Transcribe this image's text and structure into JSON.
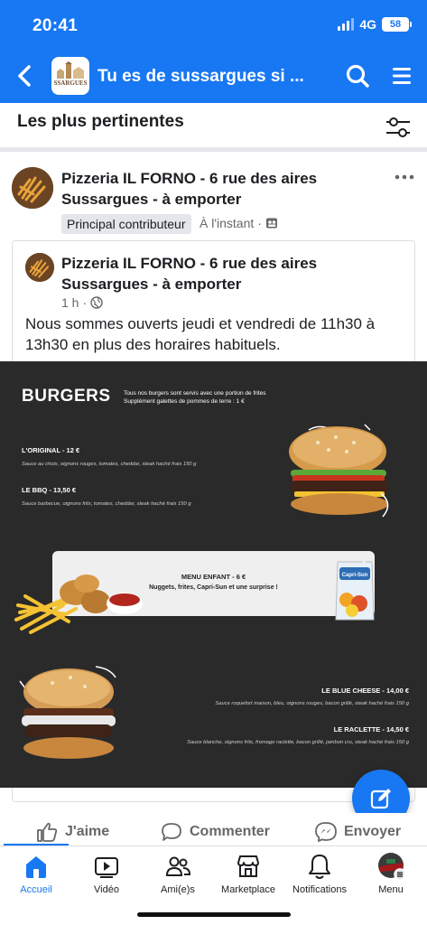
{
  "status_bar": {
    "time": "20:41",
    "network": "4G",
    "battery": "58"
  },
  "header": {
    "group_logo_text": "SSARGUES",
    "title": "Tu es de sussargues si ...",
    "icons": [
      "back-icon",
      "search-icon",
      "hamburger-menu-icon"
    ]
  },
  "sort": {
    "label": "Les plus pertinentes",
    "icon": "filter-sliders-icon"
  },
  "post": {
    "author_line1": "Pizzeria IL FORNO - 6 rue des aires",
    "author_line2": "Sussargues - à emporter",
    "badge": "Principal contributeur",
    "time": "À l'instant",
    "separator": "·",
    "shared": {
      "author_line1": "Pizzeria IL FORNO - 6 rue des aires",
      "author_line2": "Sussargues - à emporter",
      "time": "1 h",
      "separator": "·",
      "text": "Nous sommes ouverts jeudi et vendredi de 11h30 à 13h30 en plus des horaires habituels."
    }
  },
  "menu_image": {
    "title": "BURGERS",
    "note_line1": "Tous nos burgers sont servis avec une portion de frites",
    "note_line2": "Supplément galettes de pommes de terre : 1 €",
    "items": [
      {
        "name": "L'ORIGINAL - 12 €",
        "desc": "Sauce au choix, oignons rouges, tomates, cheddar, steak haché frais 150 g"
      },
      {
        "name": "LE BBQ - 13,50 €",
        "desc": "Sauce barbecue, oignons frits, tomates, cheddar, steak haché frais 150 g"
      },
      {
        "name": "LE BLUE CHEESE - 14,00 €",
        "desc": "Sauce roquefort maison, bleu, oignons rouges, bacon grillé, steak haché frais 150 g"
      },
      {
        "name": "LE RACLETTE - 14,50 €",
        "desc": "Sauce blanche, oignons frits, fromage raclette, bacon grillé, jambon cru, steak haché frais 150 g"
      }
    ],
    "enfant_title": "MENU ENFANT - 6 €",
    "enfant_sub": "Nuggets, frites, Capri-Sun et une surprise !",
    "juice_brand": "Capri-Sun"
  },
  "actions": {
    "like": "J'aime",
    "comment": "Commenter",
    "share": "Envoyer"
  },
  "tabs": [
    {
      "label": "Accueil",
      "icon": "home-icon",
      "active": true
    },
    {
      "label": "Vidéo",
      "icon": "video-icon",
      "active": false
    },
    {
      "label": "Ami(e)s",
      "icon": "friends-icon",
      "active": false
    },
    {
      "label": "Marketplace",
      "icon": "marketplace-icon",
      "active": false
    },
    {
      "label": "Notifications",
      "icon": "bell-icon",
      "active": false
    },
    {
      "label": "Menu",
      "icon": "profile-menu-icon",
      "active": false
    }
  ],
  "colors": {
    "brand": "#1877f2",
    "menu_bg": "#2a2a2a",
    "secondary_text": "#65676b"
  }
}
